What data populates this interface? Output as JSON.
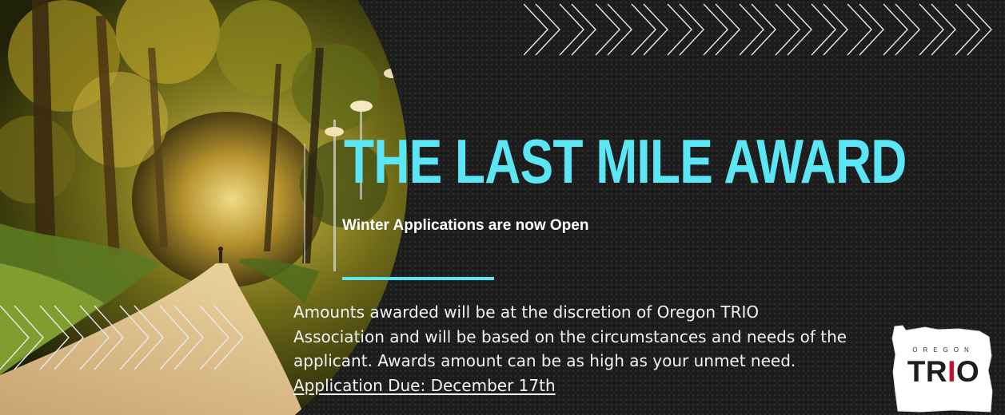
{
  "banner": {
    "title": "THE LAST MILE AWARD",
    "subtitle": "Winter Applications are now Open",
    "body": "Amounts awarded will be at the discretion of Oregon TRIO Association and will be based on the circumstances and needs of the applicant. Awards amount can be as high as your unmet need.",
    "due": "Application Due: December 17th"
  },
  "logo": {
    "top_text": "OREGON",
    "main_text": "TRIO",
    "main_prefix": "TR",
    "main_accent": "I",
    "main_suffix": "O"
  },
  "colors": {
    "background": "#1c1c1d",
    "title": "#5ae6f5",
    "accent_line": "#5ae6f5",
    "text": "#ffffff",
    "logo_accent": "#c8102e"
  },
  "decorations": {
    "photo": "tree-lined-path-photo",
    "chevrons": "chevron-pattern"
  }
}
